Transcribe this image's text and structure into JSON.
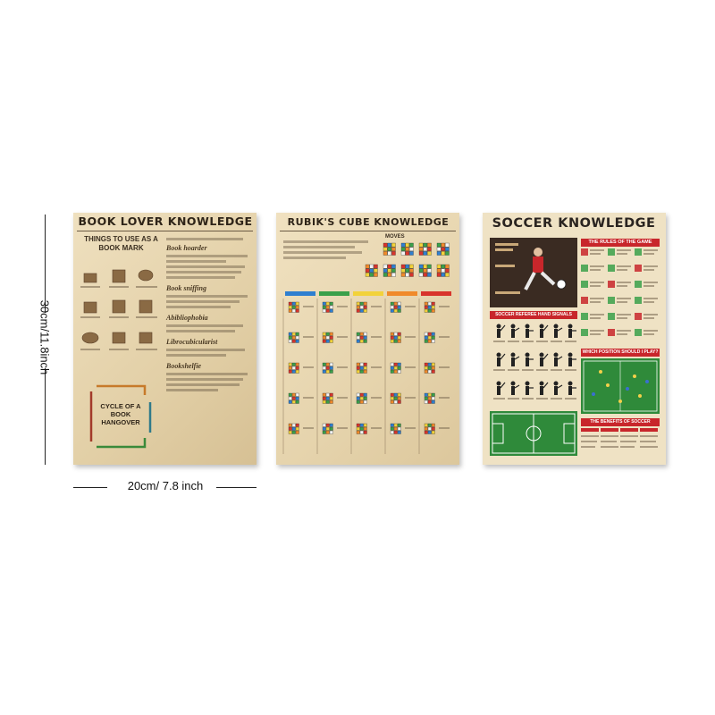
{
  "dimensions": {
    "height_label": "30cm/11.8inch",
    "width_label": "20cm/ 7.8 inch"
  },
  "posters": {
    "book": {
      "title": "BOOK LOVER KNOWLEDGE",
      "bookmark_heading": "THINGS TO USE AS A BOOK MARK",
      "cycle_heading": "CYCLE OF A BOOK HANGOVER",
      "term_1": "Book hoarder",
      "term_2": "Book sniffing",
      "term_3": "Abibliophobia",
      "term_4": "Librocubicularist",
      "term_5": "Bookshelfie"
    },
    "rubik": {
      "title": "RUBIK'S CUBE KNOWLEDGE",
      "moves_label": "MOVES"
    },
    "soccer": {
      "title": "SOCCER KNOWLEDGE",
      "rules_heading": "THE RULES OF THE GAME",
      "signals_heading": "SOCCER REFEREE HAND SIGNALS",
      "position_heading": "WHICH POSITION SHOULD I PLAY?",
      "benefits_heading": "THE BENEFITS OF SOCCER"
    }
  },
  "colors": {
    "parchment": "#e8d7b2",
    "rubik_parchment": "#e9d9b4",
    "soccer_bg": "#efe2c4",
    "soccer_dark": "#3a2b22",
    "soccer_red": "#c8262b",
    "pitch_green": "#2f8a3a"
  }
}
